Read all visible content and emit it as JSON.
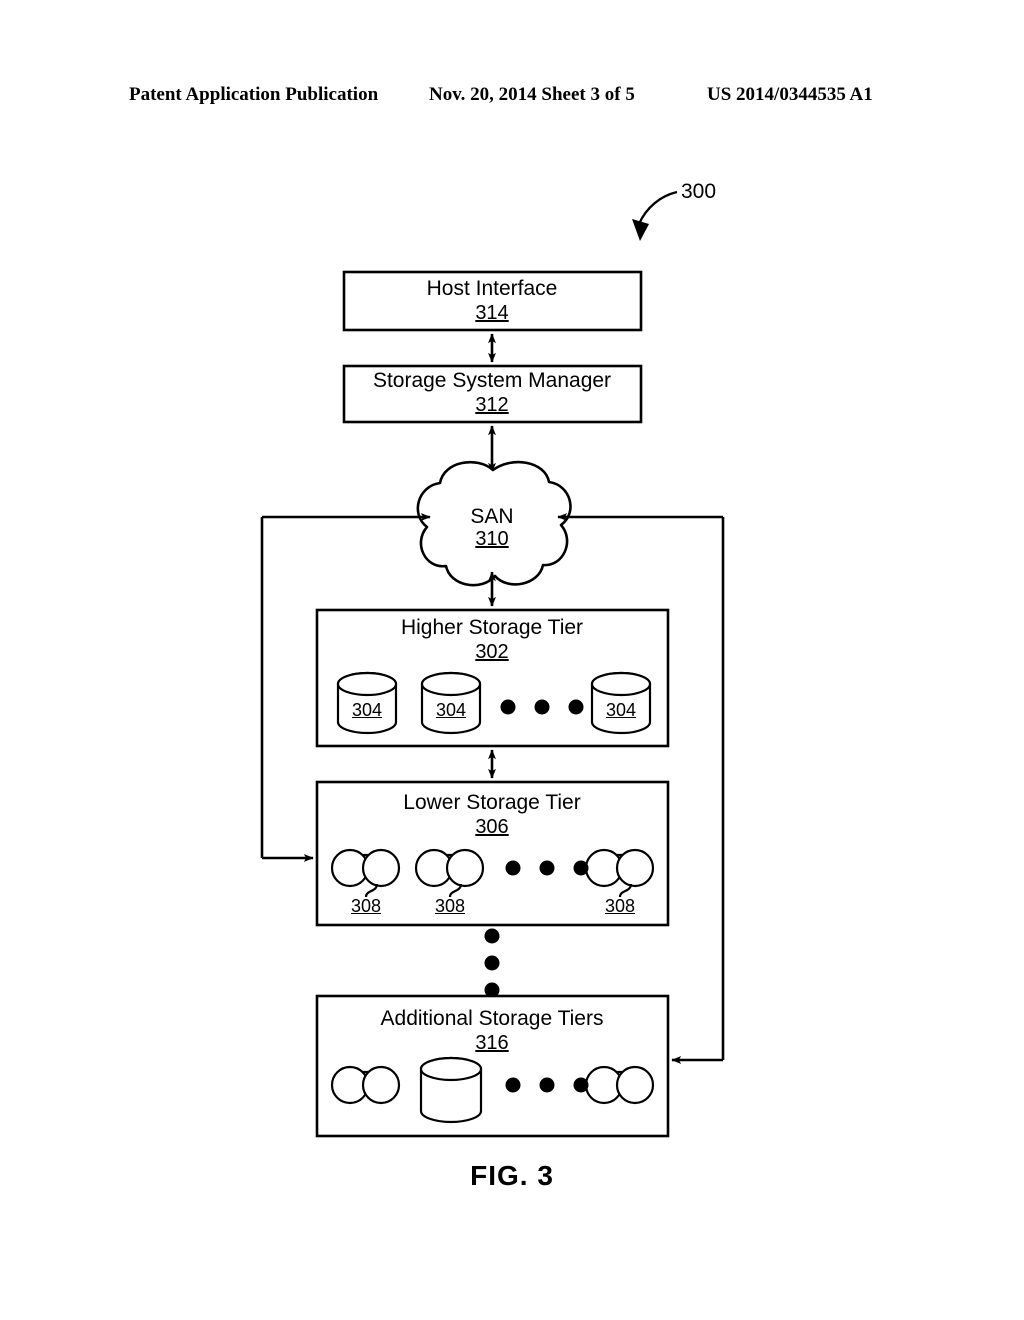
{
  "header": {
    "left": "Patent Application Publication",
    "middle": "Nov. 20, 2014  Sheet 3 of 5",
    "right": "US 2014/0344535 A1"
  },
  "figure": {
    "caption": "FIG. 3",
    "system_callout": "300",
    "boxes": [
      {
        "id": "host-interface",
        "title": "Host Interface",
        "ref": "314"
      },
      {
        "id": "storage-system-manager",
        "title": "Storage System Manager",
        "ref": "312"
      },
      {
        "id": "higher-storage-tier",
        "title": "Higher Storage Tier",
        "ref": "302"
      },
      {
        "id": "lower-storage-tier",
        "title": "Lower Storage Tier",
        "ref": "306"
      },
      {
        "id": "additional-storage-tiers",
        "title": "Additional Storage Tiers",
        "ref": "316"
      }
    ],
    "cloud": {
      "title": "SAN",
      "ref": "310"
    },
    "higher_tier_disks": [
      {
        "ref": "304"
      },
      {
        "ref": "304"
      },
      {
        "ref": "304"
      }
    ],
    "lower_tier_tapes": [
      {
        "ref": "308"
      },
      {
        "ref": "308"
      },
      {
        "ref": "308"
      }
    ],
    "additional_tier_media": [
      {
        "kind": "tape-drive-icon",
        "ref": ""
      },
      {
        "kind": "disk-cylinder-icon",
        "ref": ""
      },
      {
        "kind": "tape-drive-icon",
        "ref": ""
      }
    ],
    "ellipsis_glyph": "• • •",
    "colors": {
      "ink": "#000000",
      "paper": "#ffffff"
    }
  }
}
